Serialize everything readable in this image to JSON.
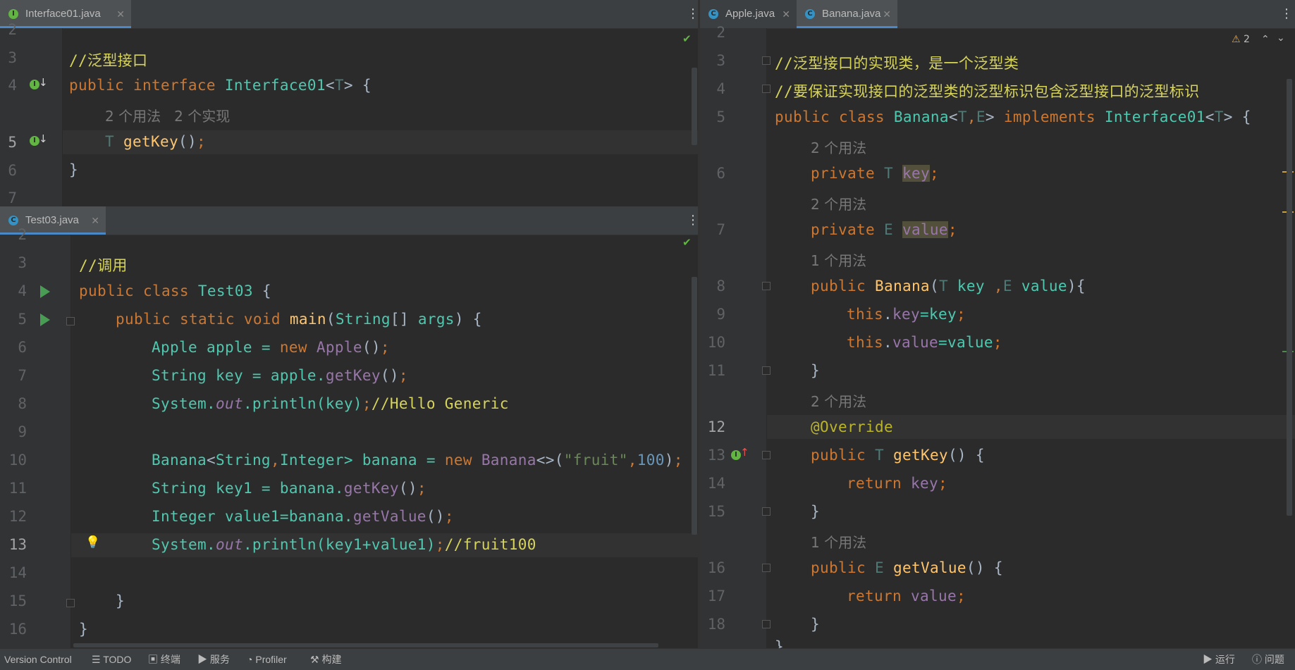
{
  "top_left": {
    "tab": "Interface01.java",
    "lines": [
      "2",
      "3",
      "4",
      "5",
      "6",
      "7"
    ],
    "usage_hint": "2 个用法   2 个实现",
    "code": {
      "comment": "//泛型接口",
      "l4": {
        "kw1": "public",
        "kw2": "interface",
        "name": "Interface01",
        "lt": "<",
        "tparam": "T",
        "rest": "> {"
      },
      "l5": {
        "tparam": "T",
        "fn": "getKey",
        "paren": "()",
        "semi": ";"
      },
      "l6": "}"
    }
  },
  "bottom_left": {
    "tab": "Test03.java",
    "lines": [
      "2",
      "3",
      "4",
      "5",
      "6",
      "7",
      "8",
      "9",
      "10",
      "11",
      "12",
      "13",
      "14",
      "15",
      "16"
    ],
    "code": {
      "c3": "//调用",
      "c4": {
        "kw": "public class",
        "name": "Test03",
        "rest": " {"
      },
      "c5": {
        "kw": "public static void",
        "fn": "main",
        "p1": "(",
        "type": "String",
        "p2": "[] ",
        "arg": "args",
        "p3": ") {"
      },
      "c6": {
        "type": "Apple",
        "var": " apple = ",
        "kw": "new",
        "ctor": "Apple",
        "p": "()",
        "semi": ";"
      },
      "c7": {
        "type": "String",
        "var": " key = apple.",
        "fn": "getKey",
        "p": "()",
        "semi": ";"
      },
      "c8": {
        "obj": "System.",
        "field": "out",
        "call": ".println(key)",
        "semi": ";",
        "cm": "//Hello Generic"
      },
      "c10": {
        "type1": "Banana",
        "lt": "<",
        "type2": "String",
        "comma": ",",
        "type3": "Integer",
        "gt": "> banana = ",
        "kw": "new",
        "ctor": "Banana",
        "diamond": "<>(",
        "str": "\"fruit\"",
        "comma2": ",",
        "num": "100",
        "end": ")",
        "semi": ";"
      },
      "c11": {
        "type": "String",
        "var": " key1 = banana.",
        "fn": "getKey",
        "p": "()",
        "semi": ";"
      },
      "c12": {
        "type": "Integer",
        "var": " value1=banana.",
        "fn": "getValue",
        "p": "()",
        "semi": ";"
      },
      "c13": {
        "obj": "System.",
        "field": "out",
        "call": ".println(key1+value1)",
        "semi": ";",
        "cm": "//fruit100"
      },
      "c15": "}",
      "c16": "}"
    }
  },
  "right": {
    "tabs": [
      "Apple.java",
      "Banana.java"
    ],
    "warning_count": "2",
    "lines": [
      "2",
      "3",
      "4",
      "5",
      "6",
      "7",
      "8",
      "9",
      "10",
      "11",
      "12",
      "13",
      "14",
      "15",
      "16",
      "17",
      "18"
    ],
    "hints": {
      "h6": "2 个用法",
      "h7": "2 个用法",
      "h8": "1 个用法",
      "h12": "2 个用法",
      "h16": "1 个用法"
    },
    "code": {
      "r3": "//泛型接口的实现类，是一个泛型类",
      "r4": "//要保证实现接口的泛型类的泛型标识包含泛型接口的泛型标识",
      "r5": {
        "kw": "public class",
        "name": "Banana",
        "lt": "<",
        "t": "T",
        "comma": ",",
        "e": "E",
        "gt": "> ",
        "kw2": "implements",
        "iface": "Interface01",
        "lt2": "<",
        "t2": "T",
        "rest": "> {"
      },
      "r6": {
        "kw": "private",
        "t": "T",
        "field": "key",
        "semi": ";"
      },
      "r7": {
        "kw": "private",
        "t": "E",
        "field": "value",
        "semi": ";"
      },
      "r8": {
        "kw": "public",
        "fn": "Banana",
        "p1": "(",
        "t": "T",
        "a1": " key ",
        "comma": ",",
        "e": "E",
        "a2": " value",
        "p2": "){"
      },
      "r9": {
        "kw": "this",
        "dot": ".",
        "field": "key",
        "eq": "=key",
        "semi": ";"
      },
      "r10": {
        "kw": "this",
        "dot": ".",
        "field": "value",
        "eq": "=value",
        "semi": ";"
      },
      "r11": "}",
      "r12": "@Override",
      "r13": {
        "kw": "public",
        "t": "T",
        "fn": "getKey",
        "rest": "() {"
      },
      "r14": {
        "kw": "return",
        "field": "key",
        "semi": ";"
      },
      "r15": "}",
      "r16": {
        "kw": "public",
        "t": "E",
        "fn": "getValue",
        "rest": "() {"
      },
      "r17": {
        "kw": "return",
        "field": "value",
        "semi": ";"
      },
      "r18": "}",
      "r19": "}"
    }
  },
  "status_bar": {
    "left": [
      "Version Control",
      "TODO",
      "终端",
      "服务",
      "Profiler",
      "构建"
    ],
    "right": [
      "运行",
      "问题"
    ]
  },
  "icons": [
    "interface-file-icon",
    "class-file-icon",
    "run-icon",
    "implements-icon",
    "overrides-icon",
    "warning-icon",
    "check-icon",
    "lightbulb-icon",
    "fold-icon",
    "more-icon",
    "close-icon"
  ]
}
